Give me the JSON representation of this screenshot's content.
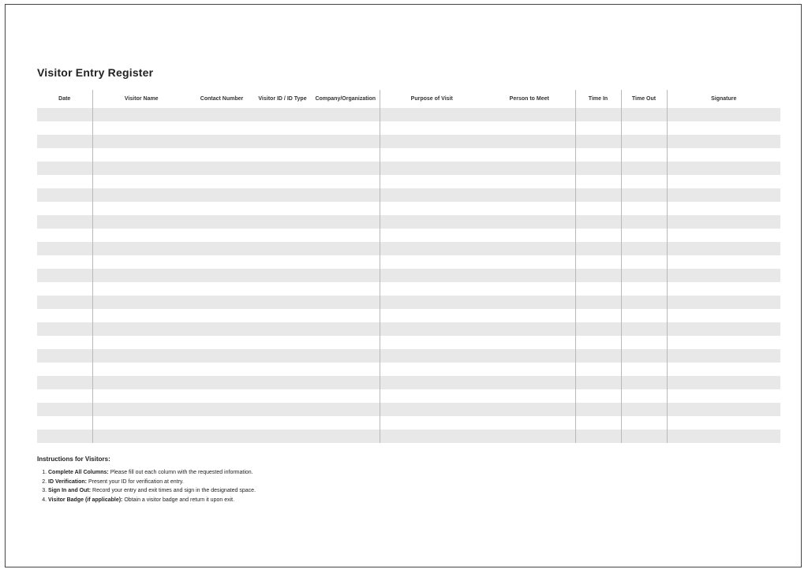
{
  "title": "Visitor Entry Register",
  "columns": [
    {
      "label": "Date",
      "width": 70,
      "hsep": true,
      "bsep": true
    },
    {
      "label": "Visitor Name",
      "width": 124,
      "hsep": false,
      "bsep": false
    },
    {
      "label": "Contact Number",
      "width": 80,
      "hsep": false,
      "bsep": false
    },
    {
      "label": "Visitor ID / ID Type",
      "width": 74,
      "hsep": false,
      "bsep": false
    },
    {
      "label": "Company/Organization",
      "width": 86,
      "hsep": true,
      "bsep": true
    },
    {
      "label": "Purpose of Visit",
      "width": 132,
      "hsep": false,
      "bsep": false
    },
    {
      "label": "Person to Meet",
      "width": 116,
      "hsep": true,
      "bsep": true
    },
    {
      "label": "Time In",
      "width": 58,
      "hsep": true,
      "bsep": true
    },
    {
      "label": "Time Out",
      "width": 58,
      "hsep": true,
      "bsep": true
    },
    {
      "label": "Signature",
      "width": 144,
      "hsep": false,
      "bsep": false
    }
  ],
  "row_count": 25,
  "instructions_heading": "Instructions for Visitors:",
  "instructions": [
    {
      "lead": "Complete All Columns:",
      "text": " Please fill out each column with the requested information."
    },
    {
      "lead": "ID Verification:",
      "text": " Present your ID for verification at entry."
    },
    {
      "lead": "Sign In and Out:",
      "text": " Record your entry and exit times and sign in the designated space."
    },
    {
      "lead": "Visitor Badge (if applicable):",
      "text": " Obtain a visitor badge and return it upon exit."
    }
  ]
}
